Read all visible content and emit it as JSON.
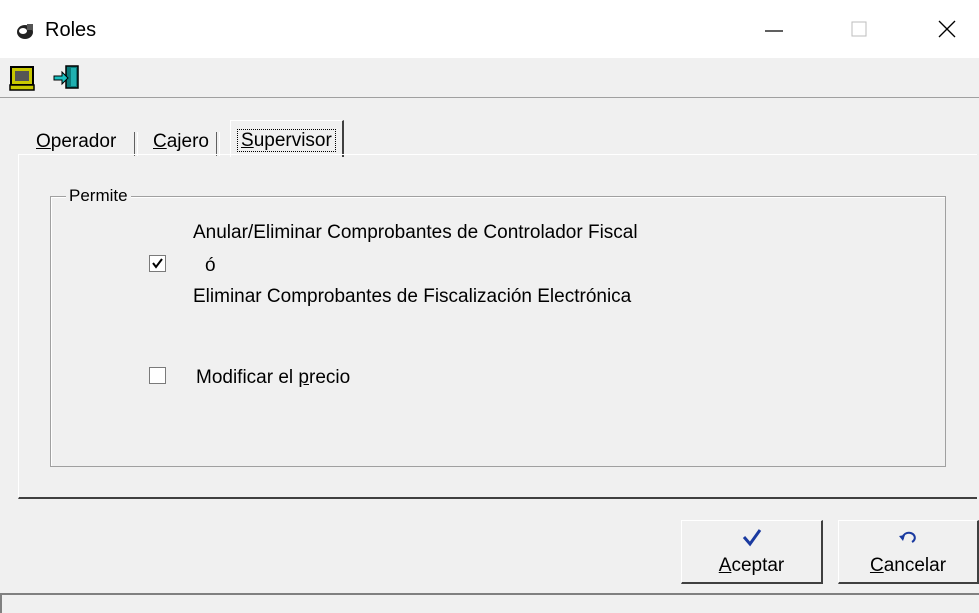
{
  "window": {
    "title": "Roles",
    "controls": [
      "minimize",
      "maximize",
      "close"
    ]
  },
  "toolbar": {
    "buttons": [
      "monitor-icon",
      "exit-door-icon"
    ]
  },
  "tabs": [
    {
      "label_first": "O",
      "label_rest": "perador",
      "selected": false
    },
    {
      "label_first": "C",
      "label_rest": "ajero",
      "selected": false
    },
    {
      "label_first": "S",
      "label_rest": "upervisor",
      "selected": true
    }
  ],
  "group": {
    "legend": "Permite",
    "options": [
      {
        "checked": true,
        "line1": "Anular/Eliminar Comprobantes de Controlador Fiscal",
        "line2": "ó",
        "line3": "Eliminar Comprobantes de Fiscalización Electrónica"
      },
      {
        "checked": false,
        "label_before": "Modificar el ",
        "label_accel": "p",
        "label_after": "recio"
      }
    ]
  },
  "buttons": {
    "ok": {
      "accel": "A",
      "rest": "ceptar",
      "icon": "checkmark-icon"
    },
    "cancel": {
      "accel": "C",
      "rest": "ancelar",
      "icon": "undo-arrow-icon"
    }
  },
  "colors": {
    "background": "#f0f0f0",
    "check_blue": "#1a3aa0"
  }
}
